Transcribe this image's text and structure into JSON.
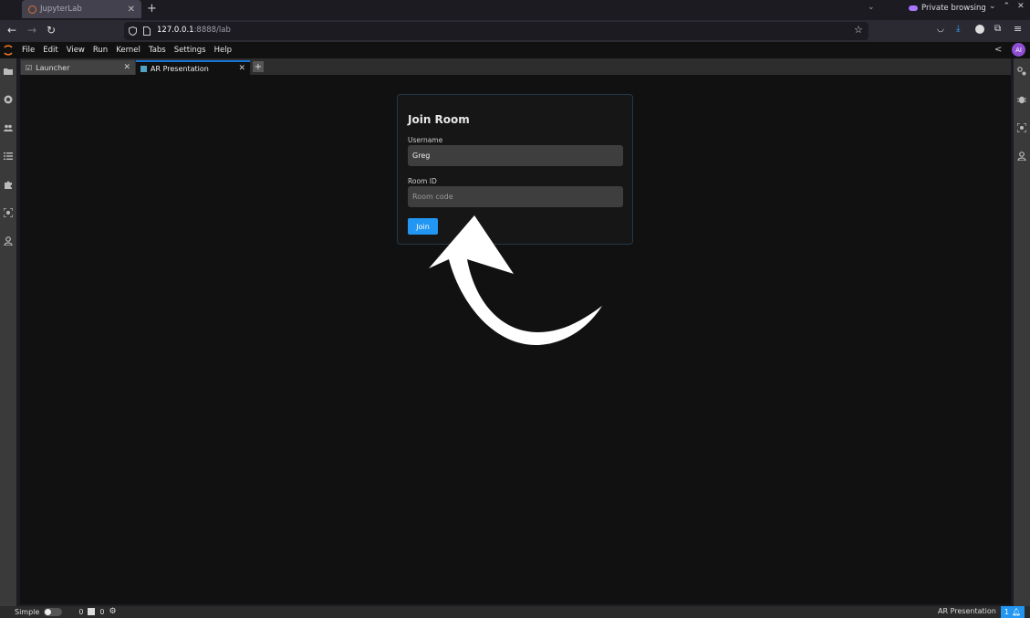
{
  "browser": {
    "tab_title": "JupyterLab",
    "new_tab": "+",
    "private_label": "Private browsing",
    "url_host": "127.0.0.1",
    "url_rest": ":8888/lab"
  },
  "menubar": {
    "items": [
      "File",
      "Edit",
      "View",
      "Run",
      "Kernel",
      "Tabs",
      "Settings",
      "Help"
    ],
    "avatar_initials": "AI"
  },
  "dock_tabs": [
    {
      "label": "Launcher"
    },
    {
      "label": "AR Presentation"
    }
  ],
  "join_form": {
    "title": "Join Room",
    "username_label": "Username",
    "username_value": "Greg",
    "room_label": "Room ID",
    "room_placeholder": "Room code",
    "join_label": "Join"
  },
  "statusbar": {
    "mode_label": "Simple",
    "count_a": "0",
    "count_b": "0",
    "active_doc": "AR Presentation",
    "notifications": "1"
  },
  "colors": {
    "accent": "#2196f3",
    "panel_bg": "#111111",
    "card_border": "#23384a"
  }
}
